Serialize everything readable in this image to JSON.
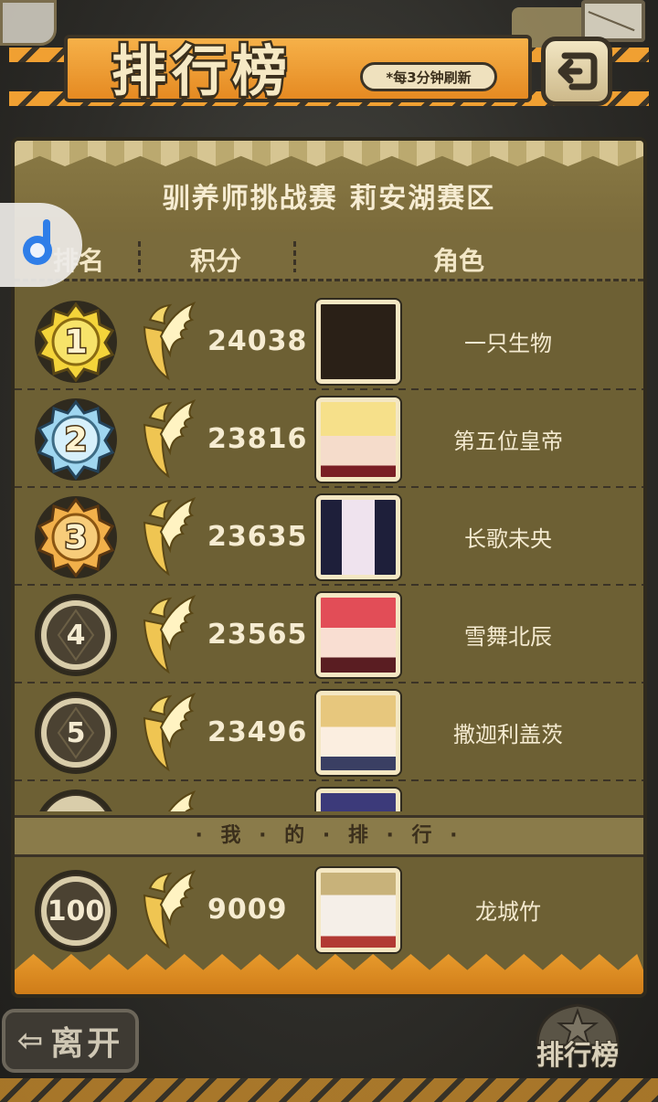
{
  "header": {
    "title": "排行榜",
    "refresh_note": "*每3分钟刷新"
  },
  "board": {
    "title": "驯养师挑战赛 莉安湖赛区",
    "columns": {
      "rank": "排名",
      "score": "积分",
      "character": "角色"
    }
  },
  "rows": [
    {
      "rank": "1",
      "score": "24038",
      "name": "一只生物",
      "medal": "gold"
    },
    {
      "rank": "2",
      "score": "23816",
      "name": "第五位皇帝",
      "medal": "silver"
    },
    {
      "rank": "3",
      "score": "23635",
      "name": "长歌未央",
      "medal": "bronze"
    },
    {
      "rank": "4",
      "score": "23565",
      "name": "雪舞北辰",
      "medal": "plain"
    },
    {
      "rank": "5",
      "score": "23496",
      "name": "撒迦利盖茨",
      "medal": "plain"
    }
  ],
  "my_rank": {
    "label": "· 我 · 的 · 排 · 行 ·",
    "rank": "100",
    "score": "9009",
    "name": "龙城竹"
  },
  "footer": {
    "leave_label": "离开",
    "leaderboard_label": "排行榜"
  },
  "colors": {
    "accent_orange": "#f0a032",
    "board_brown": "#6d6034",
    "gold": "#f4d43a",
    "silver": "#8fd0f0",
    "bronze": "#f2b04a"
  }
}
